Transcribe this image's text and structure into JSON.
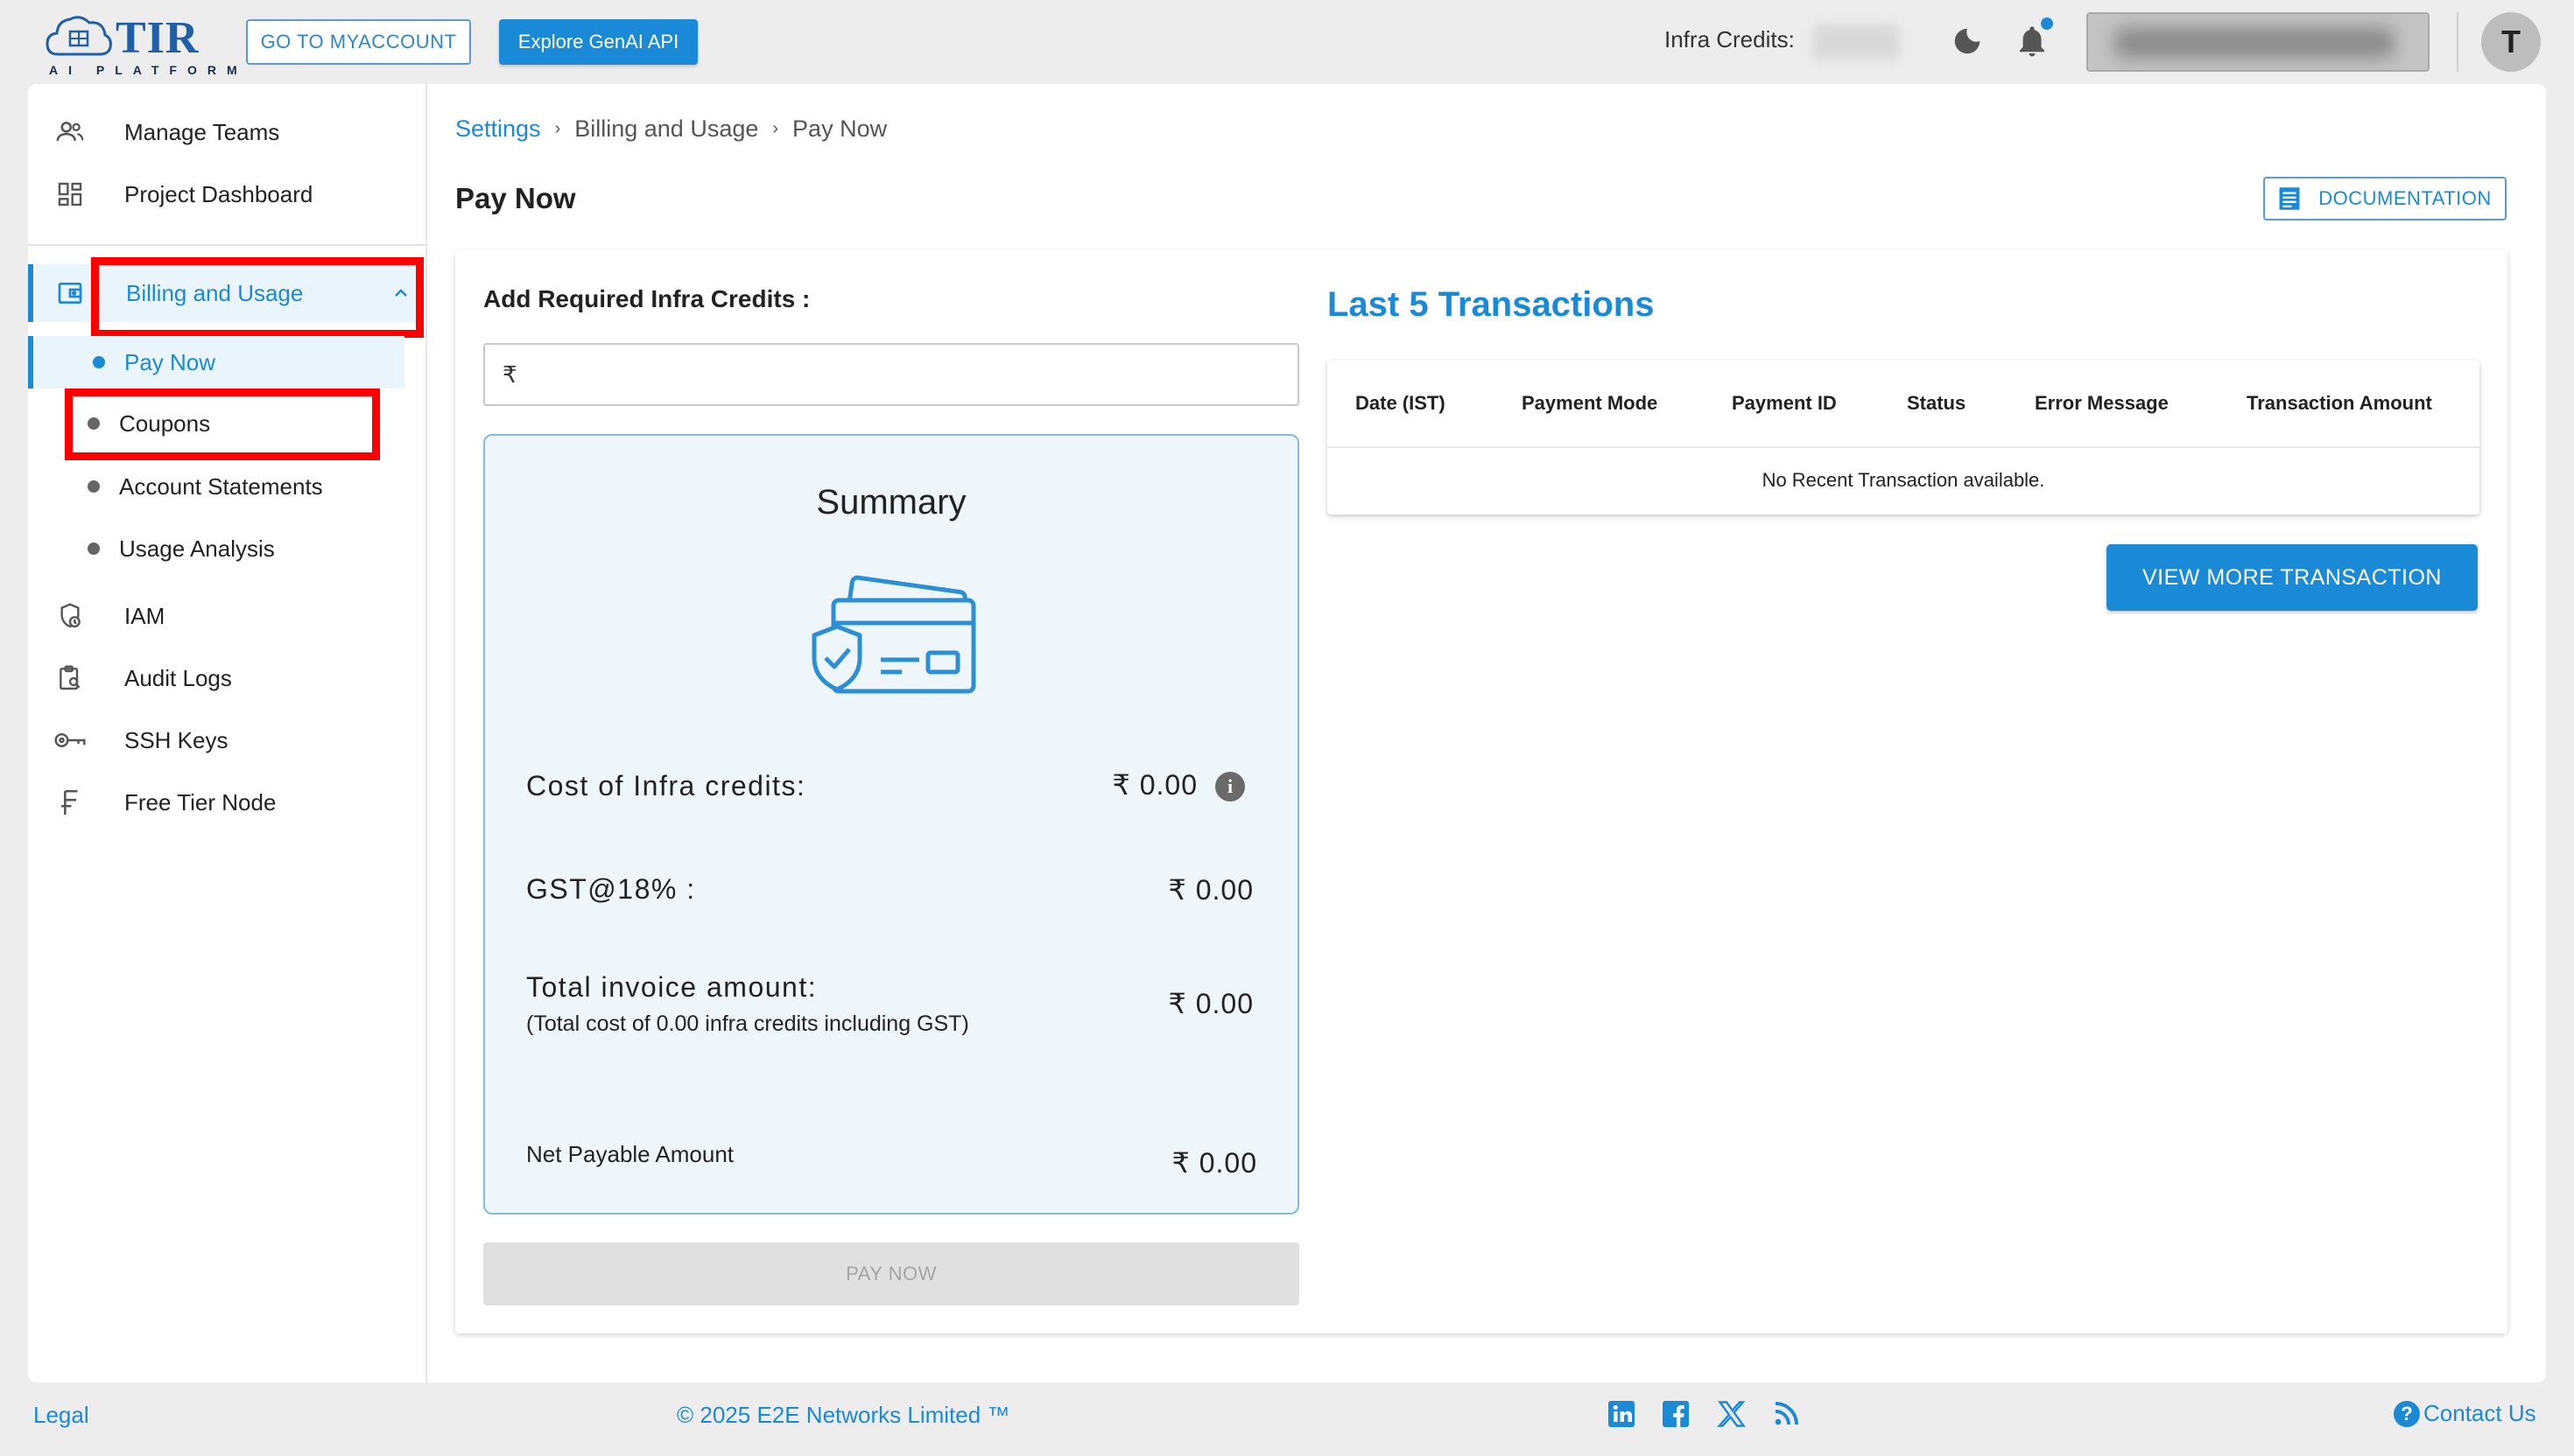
{
  "header": {
    "logo_text": "TIR",
    "logo_subtitle": "AI PLATFORM",
    "myaccount_label": "GO TO MYACCOUNT",
    "genai_label": "Explore GenAI API",
    "credits_label": "Infra Credits:",
    "avatar_letter": "T"
  },
  "sidebar": {
    "top_items": [
      {
        "label": "Manage Teams",
        "icon": "team-icon"
      },
      {
        "label": "Project Dashboard",
        "icon": "dashboard-icon"
      }
    ],
    "billing": {
      "label": "Billing and Usage",
      "icon": "wallet-icon",
      "expanded": true
    },
    "sub_items": [
      {
        "label": "Pay Now",
        "active": true
      },
      {
        "label": "Coupons"
      },
      {
        "label": "Account Statements"
      },
      {
        "label": "Usage Analysis"
      }
    ],
    "bottom_items": [
      {
        "label": "IAM",
        "icon": "iam-icon"
      },
      {
        "label": "Audit Logs",
        "icon": "audit-icon"
      },
      {
        "label": "SSH Keys",
        "icon": "key-icon"
      },
      {
        "label": "Free Tier Node",
        "icon": "free-tier-icon"
      }
    ]
  },
  "breadcrumb": [
    "Settings",
    "Billing and Usage",
    "Pay Now"
  ],
  "page_title": "Pay Now",
  "documentation_label": "DOCUMENTATION",
  "credits_form": {
    "label": "Add Required Infra Credits :",
    "currency_symbol": "₹",
    "value": ""
  },
  "summary": {
    "title": "Summary",
    "cost_label": "Cost of Infra credits:",
    "cost_value": "₹ 0.00",
    "gst_label": "GST@18% :",
    "gst_value": "₹ 0.00",
    "total_label": "Total invoice amount:",
    "total_sub": "(Total cost of 0.00 infra credits including GST)",
    "total_value": "₹ 0.00",
    "net_label": "Net Payable Amount",
    "net_value": "₹ 0.00",
    "pay_button": "PAY NOW"
  },
  "transactions": {
    "title": "Last 5 Transactions",
    "columns": [
      "Date (IST)",
      "Payment Mode",
      "Payment ID",
      "Status",
      "Error Message",
      "Transaction Amount"
    ],
    "empty_text": "No Recent Transaction available.",
    "view_more": "VIEW MORE TRANSACTION"
  },
  "footer": {
    "legal": "Legal",
    "copyright": "© 2025 E2E Networks Limited ™",
    "contact": "Contact Us"
  },
  "colors": {
    "accent": "#1a8ad6",
    "highlight_box": "#ff0000"
  }
}
